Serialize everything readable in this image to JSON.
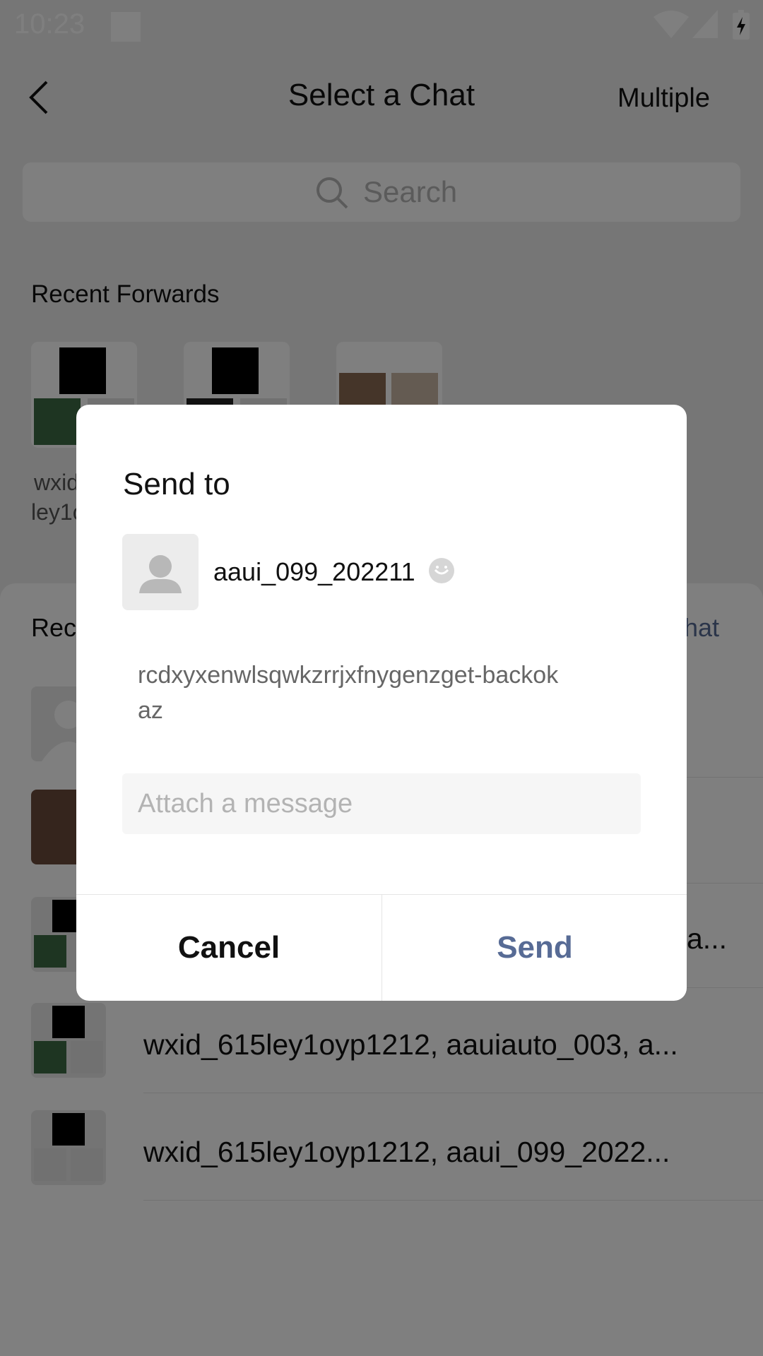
{
  "status_bar": {
    "time": "10:23"
  },
  "header": {
    "title": "Select a Chat",
    "multiple_label": "Multiple"
  },
  "search": {
    "placeholder": "Search"
  },
  "recent_forwards": {
    "title": "Recent Forwards",
    "items": [
      {
        "label_line1": "wxid",
        "label_line2": "ley1o"
      }
    ]
  },
  "recent_chats": {
    "title": "Rec",
    "new_chat_label": "hat",
    "rows": [
      {
        "text": "wxid_615ley1oyp1212, aauiauto_003, a..."
      },
      {
        "text": "wxid_615ley1oyp1212, aaui_099_2022..."
      }
    ],
    "partial_row_text": "a..."
  },
  "dialog": {
    "title": "Send to",
    "recipient_name": "aaui_099_202211",
    "content": "rcdxyxenwlsqwkzrrjxfnygenzget-backokaz",
    "message_placeholder": "Attach a message",
    "cancel_label": "Cancel",
    "send_label": "Send"
  },
  "colors": {
    "accent": "#576b95",
    "overlay": "rgba(0,0,0,0.5)"
  }
}
